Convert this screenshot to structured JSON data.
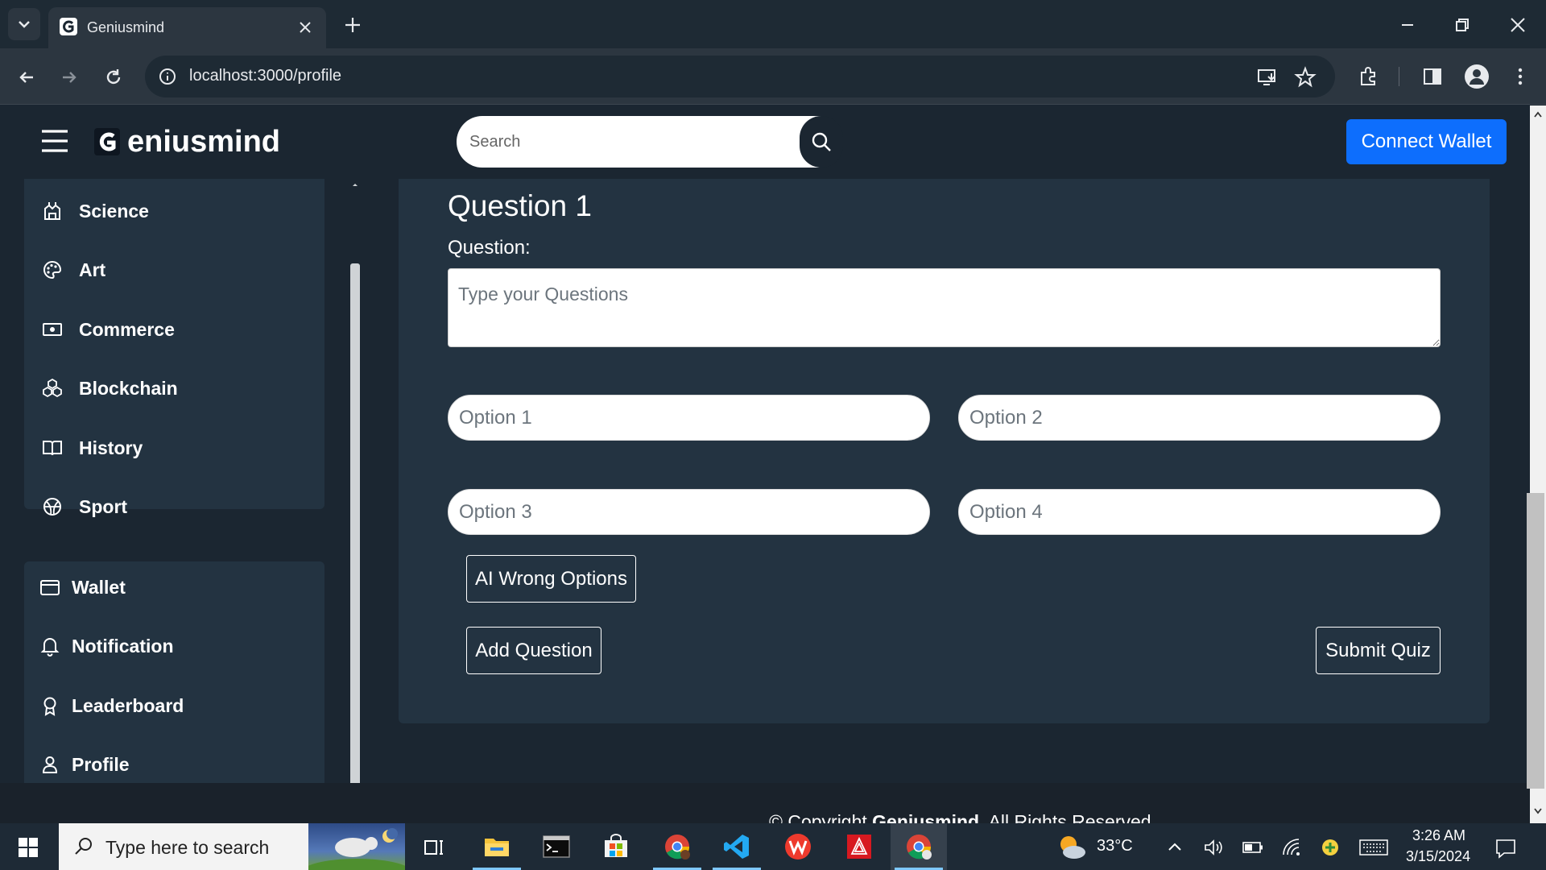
{
  "browser": {
    "tab_title": "Geniusmind",
    "url": "localhost:3000/profile"
  },
  "navbar": {
    "logo_text": "eniusmind",
    "logo_letter": "G",
    "search_placeholder": "Search",
    "connect_wallet_label": "Connect Wallet"
  },
  "sidebar": {
    "categories": [
      {
        "label": "Science",
        "icon": "science-icon"
      },
      {
        "label": "Art",
        "icon": "palette-icon"
      },
      {
        "label": "Commerce",
        "icon": "money-icon"
      },
      {
        "label": "Blockchain",
        "icon": "blockchain-icon"
      },
      {
        "label": "History",
        "icon": "book-icon"
      },
      {
        "label": "Sport",
        "icon": "ball-icon"
      }
    ],
    "account": [
      {
        "label": "Wallet",
        "icon": "wallet-icon"
      },
      {
        "label": "Notification",
        "icon": "bell-icon"
      },
      {
        "label": "Leaderboard",
        "icon": "award-icon"
      },
      {
        "label": "Profile",
        "icon": "person-icon"
      }
    ]
  },
  "quiz": {
    "heading": "Question 1",
    "question_label": "Question:",
    "question_placeholder": "Type your Questions",
    "option_placeholders": [
      "Option 1",
      "Option 2",
      "Option 3",
      "Option 4"
    ],
    "ai_wrong_options_label": "AI Wrong Options",
    "add_question_label": "Add Question",
    "submit_quiz_label": "Submit Quiz"
  },
  "footer": {
    "prefix": "© Copyright ",
    "brand": "Geniusmind",
    "suffix": ". All Rights Reserved"
  },
  "taskbar": {
    "search_placeholder": "Type here to search",
    "temperature": "33°C",
    "time": "3:26 AM",
    "date": "3/15/2024"
  },
  "colors": {
    "page_bg": "#1b2631",
    "panel_bg": "#233341",
    "accent": "#0d6efd"
  }
}
